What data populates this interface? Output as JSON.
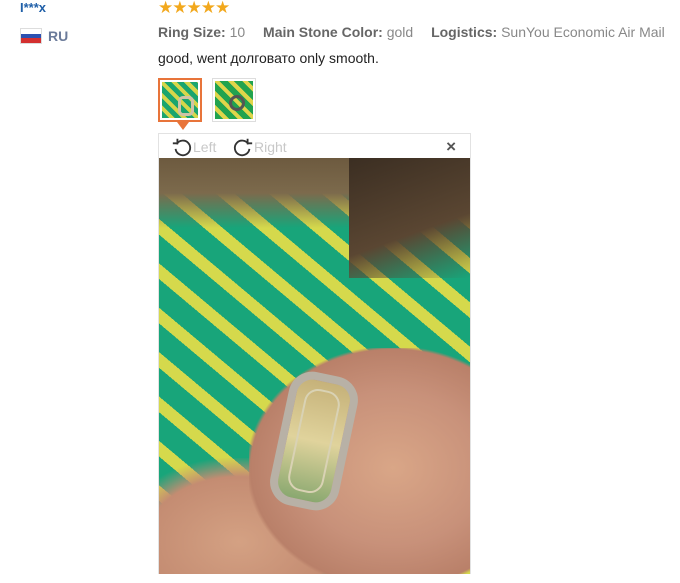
{
  "reviewer": {
    "name": "I***x",
    "country": "RU"
  },
  "rating": {
    "stars": 5,
    "glyphs": "★★★★★"
  },
  "attributes": [
    {
      "label": "Ring Size:",
      "value": "10"
    },
    {
      "label": "Main Stone Color:",
      "value": "gold"
    },
    {
      "label": "Logistics:",
      "value": "SunYou Economic Air Mail"
    }
  ],
  "review_text": "good, went долговато only smooth.",
  "viewer": {
    "rotate_left_label": "Left",
    "rotate_right_label": "Right",
    "close_glyph": "×"
  },
  "colors": {
    "accent": "#e8743a",
    "star": "#f2a81d",
    "link": "#1f5fa8"
  }
}
